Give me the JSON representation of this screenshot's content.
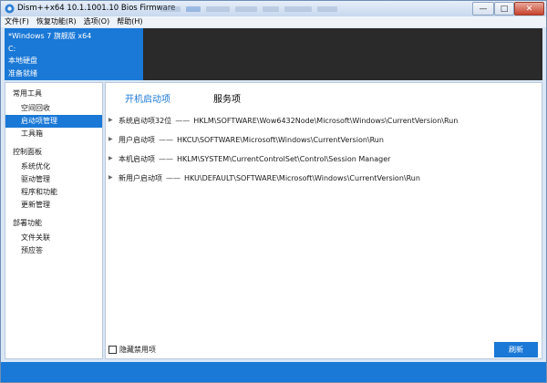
{
  "window": {
    "title": "Dism++x64 10.1.1001.10 Bios Firmware"
  },
  "menu": [
    {
      "label": "文件(F)"
    },
    {
      "label": "恢复功能(R)"
    },
    {
      "label": "选项(O)"
    },
    {
      "label": "帮助(H)"
    }
  ],
  "info": {
    "os": "*Windows 7 旗舰版 x64",
    "drive": "C:",
    "disk": "本地硬盘",
    "status": "准备就绪"
  },
  "sidebar": {
    "groups": [
      {
        "label": "常用工具",
        "items": [
          {
            "label": "空间回收"
          },
          {
            "label": "启动项管理"
          },
          {
            "label": "工具箱"
          }
        ]
      },
      {
        "label": "控制面板",
        "items": [
          {
            "label": "系统优化"
          },
          {
            "label": "驱动管理"
          },
          {
            "label": "程序和功能"
          },
          {
            "label": "更新管理"
          }
        ]
      },
      {
        "label": "部署功能",
        "items": [
          {
            "label": "文件关联"
          },
          {
            "label": "预应答"
          }
        ]
      }
    ],
    "selected": "启动项管理"
  },
  "tabs": [
    {
      "label": "开机启动项"
    },
    {
      "label": "服务项"
    }
  ],
  "entries": [
    {
      "name": "系统启动项32位",
      "sep": "——",
      "path": "HKLM\\SOFTWARE\\Wow6432Node\\Microsoft\\Windows\\CurrentVersion\\Run"
    },
    {
      "name": "用户启动项",
      "sep": "——",
      "path": "HKCU\\SOFTWARE\\Microsoft\\Windows\\CurrentVersion\\Run"
    },
    {
      "name": "本机启动项",
      "sep": "——",
      "path": "HKLM\\SYSTEM\\CurrentControlSet\\Control\\Session Manager"
    },
    {
      "name": "新用户启动项",
      "sep": "——",
      "path": "HKU\\DEFAULT\\SOFTWARE\\Microsoft\\Windows\\CurrentVersion\\Run"
    }
  ],
  "footer": {
    "hide_disabled_label": "隐藏禁用项",
    "hide_disabled_checked": false,
    "refresh_label": "刷新"
  },
  "colors": {
    "accent": "#1a78d6",
    "dark_panel": "#2a2a2a"
  },
  "icons": {
    "app": "dism-logo-icon",
    "expand": "triangle-right-icon",
    "minimize": "minimize-icon",
    "maximize": "maximize-icon",
    "close": "close-icon"
  }
}
